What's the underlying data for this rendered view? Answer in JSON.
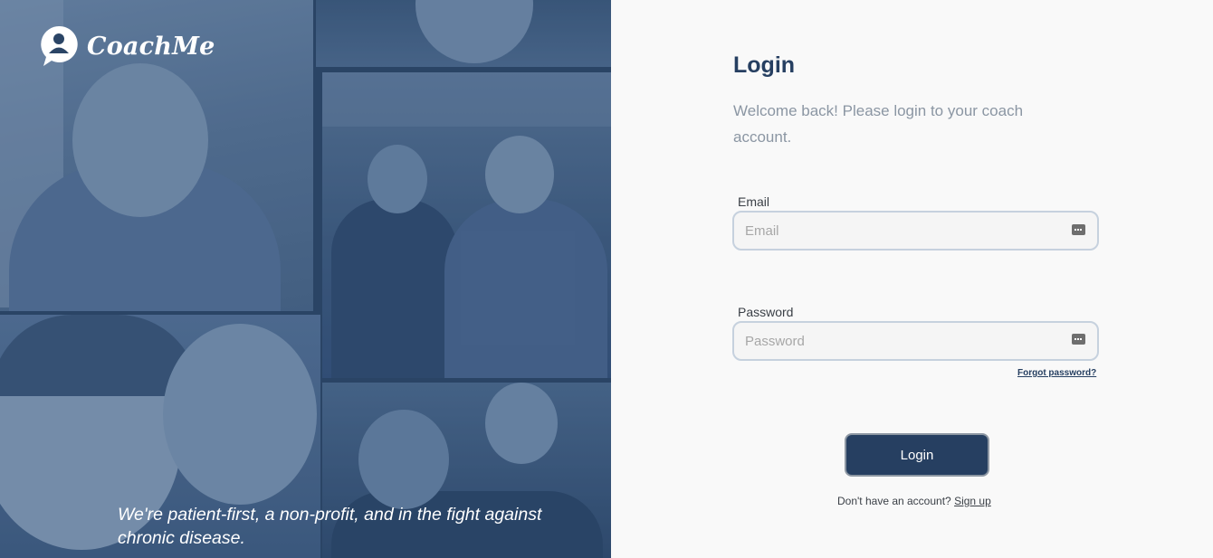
{
  "brand": {
    "name": "CoachMe",
    "icon": "user-speech-bubble-icon"
  },
  "hero": {
    "tagline": "We're patient-first, a non-profit, and in the fight against chronic disease."
  },
  "login": {
    "title": "Login",
    "subtitle": "Welcome back! Please login to your coach account.",
    "email_label": "Email",
    "email_placeholder": "Email",
    "email_value": "",
    "password_label": "Password",
    "password_placeholder": "Password",
    "password_value": "",
    "forgot_password": "Forgot password?",
    "submit_label": "Login",
    "signup_prompt": "Don't have an account?",
    "signup_link": "Sign up",
    "autofill_icon": "password-manager-icon"
  },
  "colors": {
    "brand_navy": "#263f61",
    "photo_tint": "#2b4566",
    "page_background": "#f9f9f9",
    "input_border": "#c6d1de",
    "subtitle_gray": "#8b96a3"
  }
}
